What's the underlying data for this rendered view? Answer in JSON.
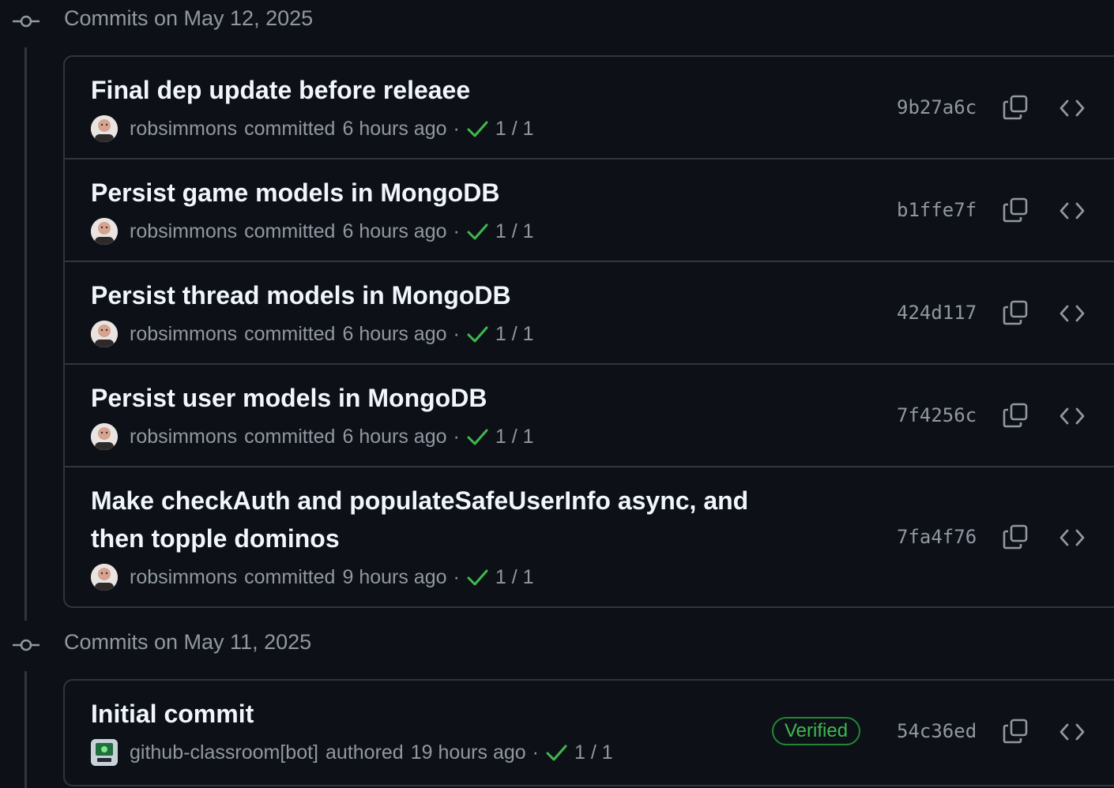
{
  "groups": [
    {
      "title": "Commits on May 12, 2025",
      "commits": [
        {
          "title_lines": [
            "Final dep update before releaee"
          ],
          "author": "robsimmons",
          "action": "committed",
          "time": "6 hours ago",
          "status": "1 / 1",
          "sha": "9b27a6c"
        },
        {
          "title_lines": [
            "Persist game models in MongoDB"
          ],
          "author": "robsimmons",
          "action": "committed",
          "time": "6 hours ago",
          "status": "1 / 1",
          "sha": "b1ffe7f"
        },
        {
          "title_lines": [
            "Persist thread models in MongoDB"
          ],
          "author": "robsimmons",
          "action": "committed",
          "time": "6 hours ago",
          "status": "1 / 1",
          "sha": "424d117"
        },
        {
          "title_lines": [
            "Persist user models in MongoDB"
          ],
          "author": "robsimmons",
          "action": "committed",
          "time": "6 hours ago",
          "status": "1 / 1",
          "sha": "7f4256c"
        },
        {
          "title_lines": [
            "Make checkAuth and populateSafeUserInfo async, and",
            "then topple dominos"
          ],
          "author": "robsimmons",
          "action": "committed",
          "time": "9 hours ago",
          "status": "1 / 1",
          "sha": "7fa4f76"
        }
      ]
    },
    {
      "title": "Commits on May 11, 2025",
      "commits": [
        {
          "title_lines": [
            "Initial commit"
          ],
          "author": "github-classroom[bot]",
          "action": "authored",
          "time": "19 hours ago",
          "status": "1 / 1",
          "sha": "54c36ed",
          "badge": "Verified"
        }
      ]
    }
  ],
  "separator": "·",
  "icons": {
    "timeline": "git-commit-icon",
    "check": "check-icon",
    "copy": "copy-icon",
    "browse": "code-icon",
    "avatar": "user-avatar",
    "bot_avatar": "bot-avatar"
  },
  "colors": {
    "background": "#0d1117",
    "border": "#30363d",
    "text": "#f0f6fc",
    "muted": "#9198a1",
    "success": "#3fb950",
    "verified_border": "#238636"
  }
}
